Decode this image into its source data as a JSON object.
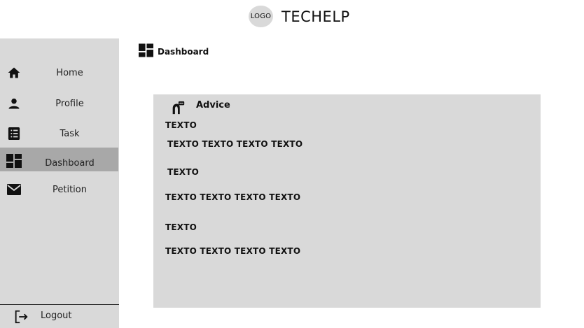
{
  "header": {
    "logo_text": "LOGO",
    "app_title": "TECHELP"
  },
  "sidebar": {
    "items": [
      {
        "label": "Home",
        "icon": "home-icon"
      },
      {
        "label": "Profile",
        "icon": "person-icon"
      },
      {
        "label": "Task",
        "icon": "task-list-icon"
      },
      {
        "label": "Dashboard",
        "icon": "dashboard-icon",
        "active": true
      },
      {
        "label": "Petition",
        "icon": "mail-icon"
      }
    ],
    "logout_label": "Logout"
  },
  "page": {
    "title": "Dashboard"
  },
  "card": {
    "title": "Advice",
    "lines": [
      "TEXTO",
      "TEXTO TEXTO TEXTO TEXTO",
      "TEXTO",
      "TEXTO TEXTO TEXTO TEXTO",
      "TEXTO",
      "TEXTO TEXTO TEXTO TEXTO"
    ]
  },
  "colors": {
    "sidebar_bg": "#d9d9d9",
    "active_item_bg": "#a8a8a8",
    "card_bg": "#d9d9d9"
  }
}
